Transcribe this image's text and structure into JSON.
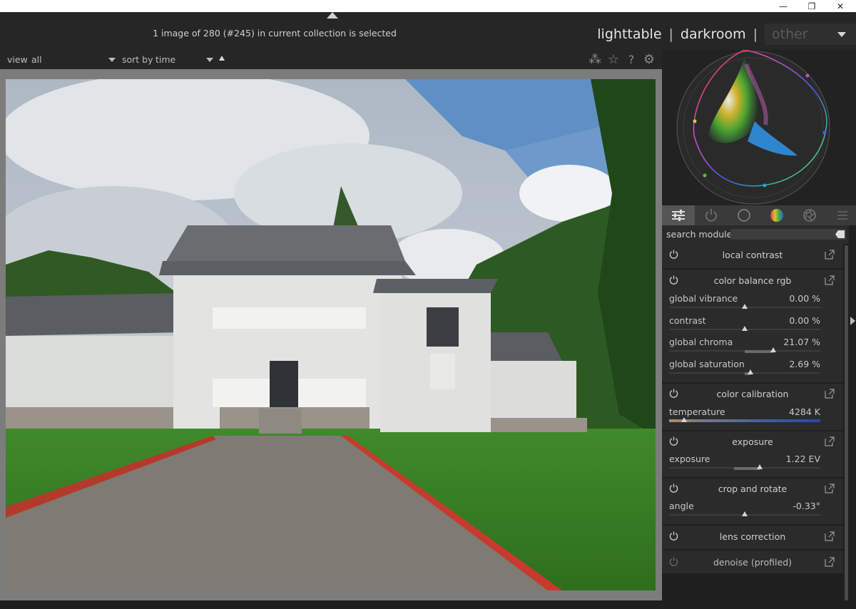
{
  "window": {
    "minimize": "—",
    "restore": "❐",
    "close": "✕"
  },
  "header": {
    "status": "1 image of 280 (#245) in current collection is selected",
    "views": {
      "lighttable": "lighttable",
      "sep": "|",
      "darkroom": "darkroom",
      "other": "other"
    }
  },
  "filterbar": {
    "view_label": "view",
    "view_value": "all",
    "sort_label": "sort by",
    "sort_value": "time",
    "icons": [
      "grouping-icon",
      "star-icon",
      "help-icon",
      "gear-icon"
    ],
    "icon_glyphs": {
      "grouping": "⁂",
      "star": "☆",
      "help": "?",
      "gear": "⚙"
    }
  },
  "search": {
    "label": "search module",
    "placeholder": ""
  },
  "tabs": [
    "quick-access-icon",
    "active-modules-icon",
    "base-icon",
    "tone-color-icon",
    "effects-icon",
    "presets-menu-icon"
  ],
  "modules": [
    {
      "name": "local contrast",
      "params": []
    },
    {
      "name": "color balance rgb",
      "params": [
        {
          "label": "global vibrance",
          "value": "0.00 %",
          "position": 0.5
        },
        {
          "label": "contrast",
          "value": "0.00 %",
          "position": 0.5
        },
        {
          "label": "global chroma",
          "value": "21.07 %",
          "position": 0.69,
          "fill_from": 0.5
        },
        {
          "label": "global saturation",
          "value": "2.69 %",
          "position": 0.54,
          "fill_from": 0.5
        }
      ]
    },
    {
      "name": "color calibration",
      "params": [
        {
          "label": "temperature",
          "value": "4284 K",
          "position": 0.1
        }
      ]
    },
    {
      "name": "exposure",
      "params": [
        {
          "label": "exposure",
          "value": "1.22 EV",
          "position": 0.6,
          "fill_from": 0.43
        }
      ]
    },
    {
      "name": "crop and rotate",
      "params": [
        {
          "label": "angle",
          "value": "-0.33°",
          "position": 0.5
        }
      ]
    },
    {
      "name": "lens correction",
      "params": []
    },
    {
      "name": "denoise (profiled)",
      "params": [],
      "disabled": true
    }
  ]
}
